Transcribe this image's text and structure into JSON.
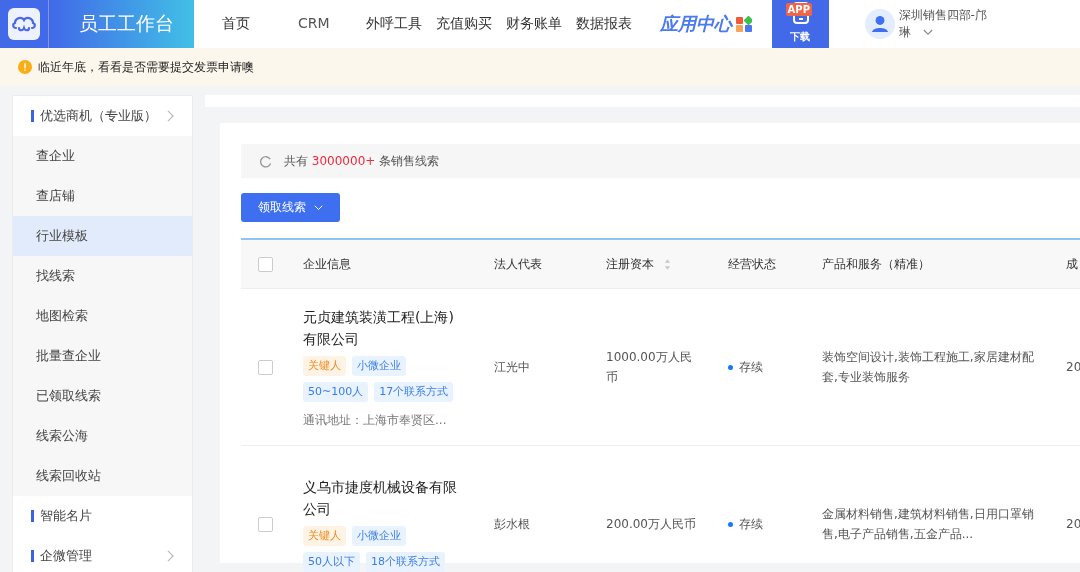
{
  "header": {
    "title": "员工工作台",
    "nav": [
      {
        "label": "首页",
        "selected": false
      },
      {
        "label": "CRM",
        "selected": false
      },
      {
        "label": "外呼工具",
        "selected": false
      },
      {
        "label": "充值购买",
        "selected": false
      },
      {
        "label": "财务账单",
        "selected": false
      },
      {
        "label": "数据报表",
        "selected": false
      }
    ],
    "app_center": "应用中心",
    "app_download": {
      "badge": "APP",
      "label": "下载"
    },
    "user": {
      "name": "深圳销售四部-邝",
      "name_line2": "琳"
    }
  },
  "notice": "临近年底，看看是否需要提交发票申请噢",
  "sidebar": {
    "items": [
      {
        "kind": "group",
        "label": "优选商机（专业版）",
        "expandable": true,
        "selected": false
      },
      {
        "kind": "item",
        "label": "查企业",
        "selected": false
      },
      {
        "kind": "item",
        "label": "查店铺",
        "selected": false
      },
      {
        "kind": "item",
        "label": "行业模板",
        "selected": true
      },
      {
        "kind": "item",
        "label": "找线索",
        "selected": false
      },
      {
        "kind": "item",
        "label": "地图检索",
        "selected": false
      },
      {
        "kind": "item",
        "label": "批量查企业",
        "selected": false
      },
      {
        "kind": "item",
        "label": "已领取线索",
        "selected": false
      },
      {
        "kind": "item",
        "label": "线索公海",
        "selected": false
      },
      {
        "kind": "item",
        "label": "线索回收站",
        "selected": false
      },
      {
        "kind": "group",
        "label": "智能名片",
        "expandable": false,
        "selected": false
      },
      {
        "kind": "group",
        "label": "企微管理",
        "expandable": true,
        "selected": false
      }
    ]
  },
  "summary": {
    "prefix": "共有",
    "count": "3000000+",
    "suffix": "条销售线索"
  },
  "claim_button": "领取线索",
  "table": {
    "select_all_checked": false,
    "columns": [
      {
        "label": "企业信息",
        "sortable": false
      },
      {
        "label": "法人代表",
        "sortable": false
      },
      {
        "label": "注册资本",
        "sortable": true
      },
      {
        "label": "经营状态",
        "sortable": false
      },
      {
        "label": "产品和服务（精准）",
        "sortable": false
      },
      {
        "label": "成"
      }
    ],
    "rows": [
      {
        "checked": false,
        "company": "元贞建筑装潢工程(上海)有限公司",
        "tags": [
          {
            "kind": "key",
            "label": "关键人"
          },
          {
            "kind": "info",
            "label": "小微企业"
          },
          {
            "kind": "info",
            "label": "50~100人"
          },
          {
            "kind": "info",
            "label": "17个联系方式"
          }
        ],
        "address": "通讯地址：上海市奉贤区...",
        "legal_rep": "江光中",
        "capital": "1000.00万人民币",
        "status": "存续",
        "color": "#1677ff",
        "products": "装饰空间设计,装饰工程施工,家居建材配套,专业装饰服务",
        "column_7": "20"
      },
      {
        "checked": false,
        "company": "义乌市捷度机械设备有限公司",
        "tags": [
          {
            "kind": "key",
            "label": "关键人"
          },
          {
            "kind": "info",
            "label": "小微企业"
          },
          {
            "kind": "info",
            "label": "50人以下"
          },
          {
            "kind": "info",
            "label": "18个联系方式"
          }
        ],
        "legal_rep": "彭水根",
        "capital": "200.00万人民币",
        "status": "存续",
        "color": "#1677ff",
        "products": "金属材料销售,建筑材料销售,日用口罩销售,电子产品销售,五金产品...",
        "column_7": "20"
      }
    ]
  }
}
